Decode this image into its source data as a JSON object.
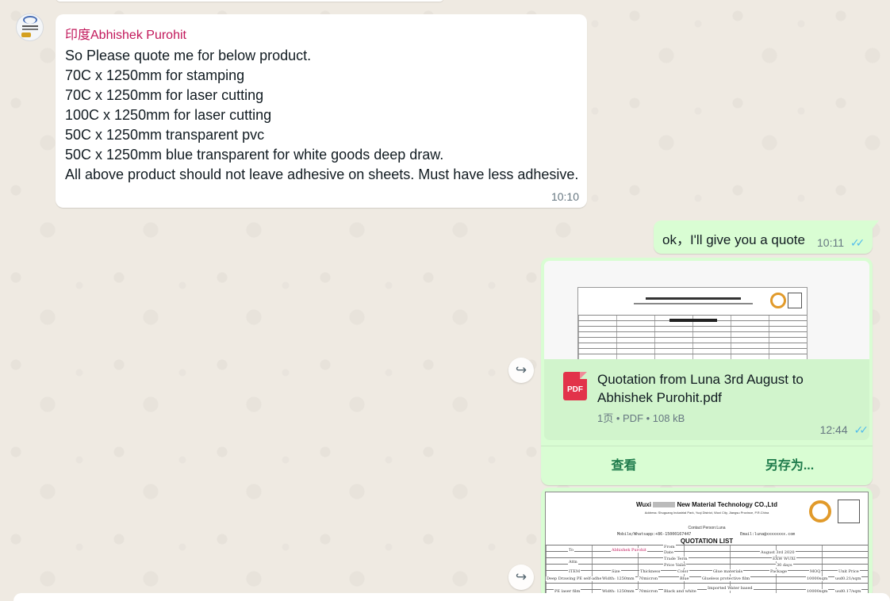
{
  "incoming": {
    "sender": "印度Abhishek Purohit",
    "lines": [
      "So Please quote me for below product.",
      "70C x 1250mm for stamping",
      "70C x 1250mm for laser cutting",
      "100C x 1250mm for laser cutting",
      "50C x 1250mm transparent pvc",
      "50C x 1250mm blue transparent for white goods deep draw.",
      "All above product should not leave adhesive on sheets. Must have less adhesive."
    ],
    "time": "10:10"
  },
  "outgoing": {
    "text": "ok，I'll give you a quote",
    "time": "10:11",
    "status_icon": "double-check-read-icon"
  },
  "document": {
    "icon_label": "PDF",
    "file_name": "Quotation from Luna 3rd August to Abhishek Purohit.pdf",
    "meta": "1页 • PDF • 108 kB",
    "time": "12:44",
    "actions": {
      "view": "查看",
      "save_as": "另存为..."
    }
  },
  "image_preview": {
    "company_before": "Wuxi",
    "company_after": "New Material Technology CO.,Ltd",
    "address": "Address: Shuguang Industrial Park, Yuqi District, Wuxi City, Jiangsu Province, P.R.China",
    "contact": "Contact Person:Luna",
    "mobile": "Mobile/Whatsapp:+86-15000167447",
    "email": "Email:luna@xxxxxxxx.com",
    "title": "QUOTATION LIST",
    "to_label": "To",
    "to_value": "Abhishek Purohit",
    "attn_label": "Attn",
    "from_label": "From",
    "date_label": "Date",
    "date_value": "August 3rd 2020",
    "trade_label": "Trade Term",
    "trade_value": "EXW WUXI",
    "valid_label": "Price Valid",
    "valid_value": "30 days",
    "headers": [
      "ITEM",
      "Size",
      "Thickness",
      "Color",
      "Glue materials",
      "Package",
      "MOQ",
      "Unit Price"
    ],
    "row1": [
      "Deep Drawing PE self-adhesive film",
      "Width: 1250mm",
      "70micron",
      "Blue",
      "Glueless protective film",
      "",
      "10000sqm",
      "usd0.21/sqm"
    ],
    "row2": [
      "PE laser film",
      "Width: 1250mm",
      "70micron",
      "Black and white",
      "Imported Water based",
      "",
      "10000sqm",
      "usd0.17/sqm"
    ]
  },
  "colors": {
    "chat_bg": "#efeae2",
    "incoming_bubble": "#ffffff",
    "outgoing_bubble": "#d9fdd3",
    "sender_name": "#c2185b",
    "read_ticks": "#53bdeb",
    "action_text": "#1d7a4a",
    "pdf_icon": "#e2334a"
  }
}
